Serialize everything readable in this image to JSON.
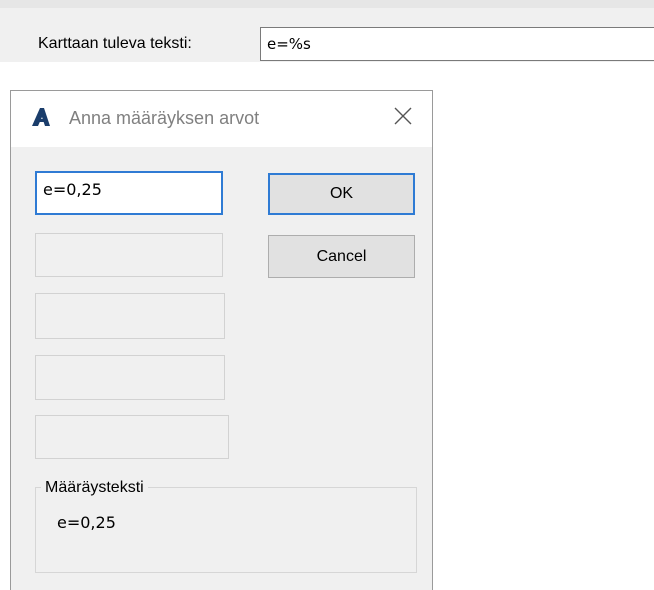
{
  "top": {
    "label": "Karttaan tuleva teksti:",
    "value": "e=%s"
  },
  "dialog": {
    "title": "Anna määräyksen arvot",
    "app_icon": "autocad-a-icon",
    "close_icon": "close-icon",
    "fields": [
      {
        "value": "e=0,25",
        "state": "focused"
      },
      {
        "value": "",
        "state": "disabled"
      },
      {
        "value": "",
        "state": "disabled"
      },
      {
        "value": "",
        "state": "disabled"
      },
      {
        "value": "",
        "state": "disabled"
      }
    ],
    "ok_label": "OK",
    "cancel_label": "Cancel",
    "group": {
      "legend": "Määräysteksti",
      "text": "e=0,25"
    }
  },
  "colors": {
    "accent": "#2f7bd4",
    "dialog_bg": "#f0f0f0"
  }
}
